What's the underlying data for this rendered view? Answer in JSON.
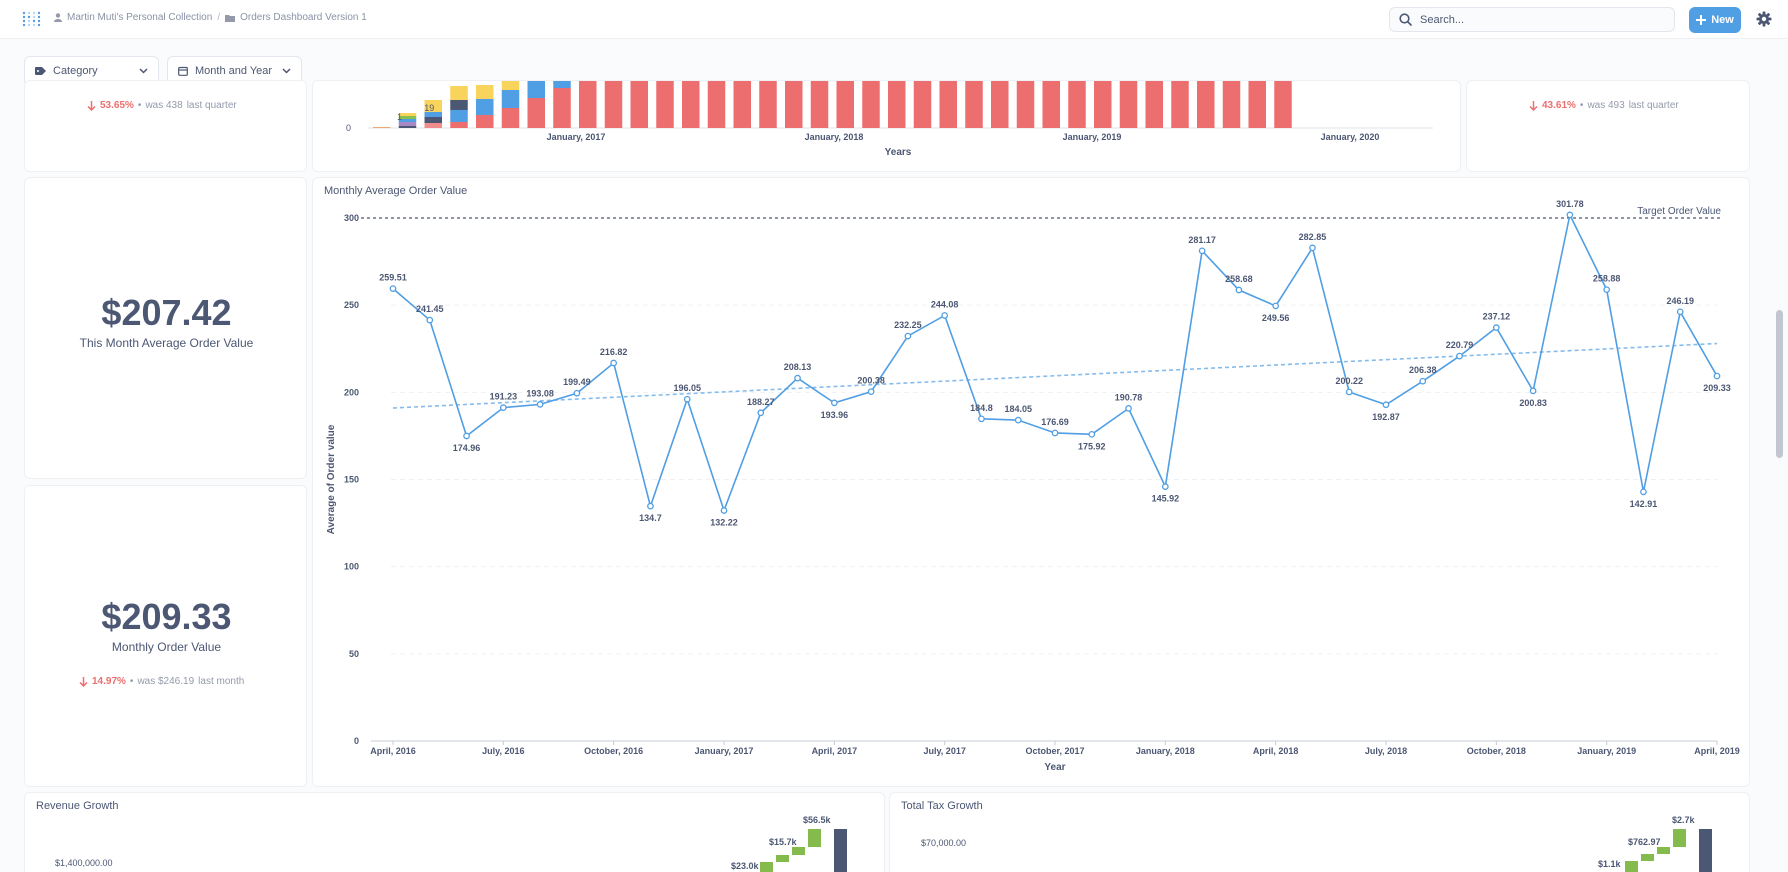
{
  "header": {
    "collection": "Martin Muti's Personal Collection",
    "dashboard": "Orders Dashboard Version 1",
    "search_placeholder": "Search...",
    "new_label": "New"
  },
  "filters": [
    {
      "label": "Category",
      "icon": "tag-icon"
    },
    {
      "label": "Month and Year",
      "icon": "calendar-icon"
    }
  ],
  "top_left_card": {
    "change": "53.65%",
    "was": "was 438",
    "period": "last quarter"
  },
  "top_right_card": {
    "change": "43.61%",
    "was": "was 493",
    "period": "last quarter"
  },
  "top_chart": {
    "xlabel": "Years",
    "ticks": [
      "January, 2017",
      "January, 2018",
      "January, 2019",
      "January, 2020"
    ],
    "y_visible_tick": "0",
    "labels": [
      "1",
      "19"
    ]
  },
  "this_month_card": {
    "value": "$207.42",
    "label": "This Month Average Order Value"
  },
  "monthly_card": {
    "value": "$209.33",
    "label": "Monthly Order Value",
    "change": "14.97%",
    "was": "was $246.19",
    "period": "last month"
  },
  "chart_data": {
    "type": "line",
    "title": "Monthly Average Order Value",
    "xlabel": "Year",
    "ylabel": "Average of Order value",
    "ylim": [
      0,
      300
    ],
    "yticks": [
      0,
      50,
      100,
      150,
      200,
      250,
      300
    ],
    "x": [
      "April, 2016",
      "May, 2016",
      "June, 2016",
      "July, 2016",
      "August, 2016",
      "September, 2016",
      "October, 2016",
      "November, 2016",
      "December, 2016",
      "January, 2017",
      "February, 2017",
      "March, 2017",
      "April, 2017",
      "May, 2017",
      "June, 2017",
      "July, 2017",
      "August, 2017",
      "September, 2017",
      "October, 2017",
      "November, 2017",
      "December, 2017",
      "January, 2018",
      "February, 2018",
      "March, 2018",
      "April, 2018",
      "May, 2018",
      "June, 2018",
      "July, 2018",
      "August, 2018",
      "September, 2018",
      "October, 2018",
      "November, 2018",
      "December, 2018",
      "January, 2019",
      "February, 2019",
      "March, 2019",
      "April, 2019"
    ],
    "values": [
      259.51,
      241.45,
      174.96,
      191.23,
      193.08,
      199.49,
      216.82,
      134.7,
      196.05,
      132.22,
      188.27,
      208.13,
      193.96,
      200.38,
      232.25,
      244.08,
      184.8,
      184.05,
      176.69,
      175.92,
      190.78,
      145.92,
      281.17,
      258.68,
      249.56,
      282.85,
      200.22,
      192.87,
      206.38,
      220.79,
      237.12,
      200.83,
      301.78,
      258.88,
      142.91,
      246.19,
      209.33
    ],
    "xticks": [
      "April, 2016",
      "July, 2016",
      "October, 2016",
      "January, 2017",
      "April, 2017",
      "July, 2017",
      "October, 2017",
      "January, 2018",
      "April, 2018",
      "July, 2018",
      "October, 2018",
      "January, 2019",
      "April, 2019"
    ],
    "goal": {
      "label": "Target Order Value",
      "value": 300
    },
    "trendline": {
      "start": 191,
      "end": 228
    },
    "color": "#509ee3",
    "grid": true
  },
  "revenue_card": {
    "title": "Revenue Growth",
    "ytick": "$1,400,000.00",
    "labels": [
      "$56.5k",
      "$15.7k",
      "$23.0k"
    ]
  },
  "tax_card": {
    "title": "Total Tax Growth",
    "ytick": "$70,000.00",
    "labels": [
      "$2.7k",
      "$762.97",
      "$1.1k"
    ]
  }
}
